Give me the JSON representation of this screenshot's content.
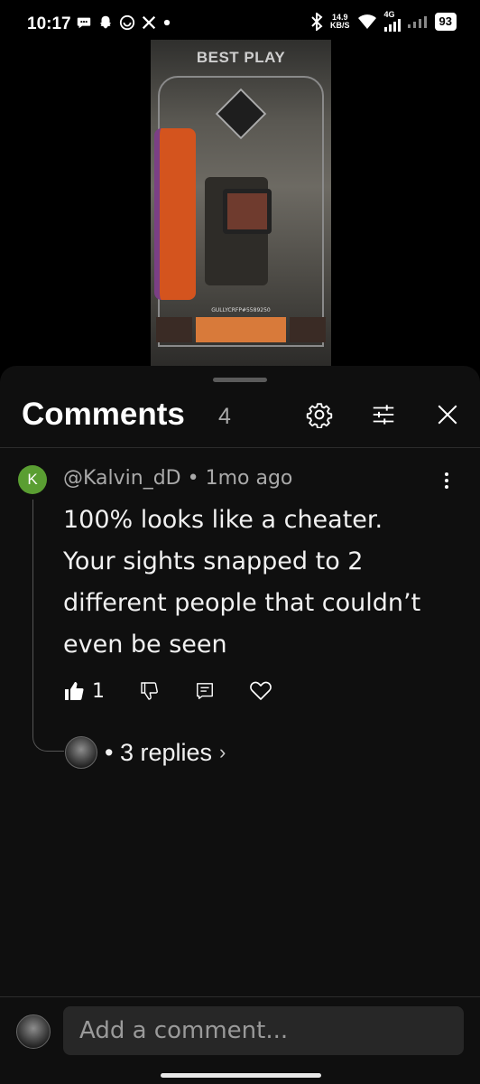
{
  "status_bar": {
    "time": "10:17",
    "net_speed_value": "14.9",
    "net_speed_unit": "KB/S",
    "network": "4G",
    "battery": "93"
  },
  "video": {
    "title": "BEST PLAY",
    "player_tag": "GULLYCRFP#5589250"
  },
  "comments_sheet": {
    "title": "Comments",
    "count": "4"
  },
  "comment": {
    "avatar_letter": "K",
    "author": "@Kalvin_dD",
    "separator": "•",
    "time": "1mo ago",
    "text": "100% looks like a cheater. Your sights snapped to 2 different people that couldn’t even be seen",
    "like_count": "1",
    "replies_label": "• 3 replies",
    "replies_chevron": "›"
  },
  "composer": {
    "placeholder": "Add a comment..."
  },
  "colors": {
    "sheet_bg": "#0f0f0f",
    "avatar_k": "#5a9e32",
    "input_bg": "#272727"
  }
}
